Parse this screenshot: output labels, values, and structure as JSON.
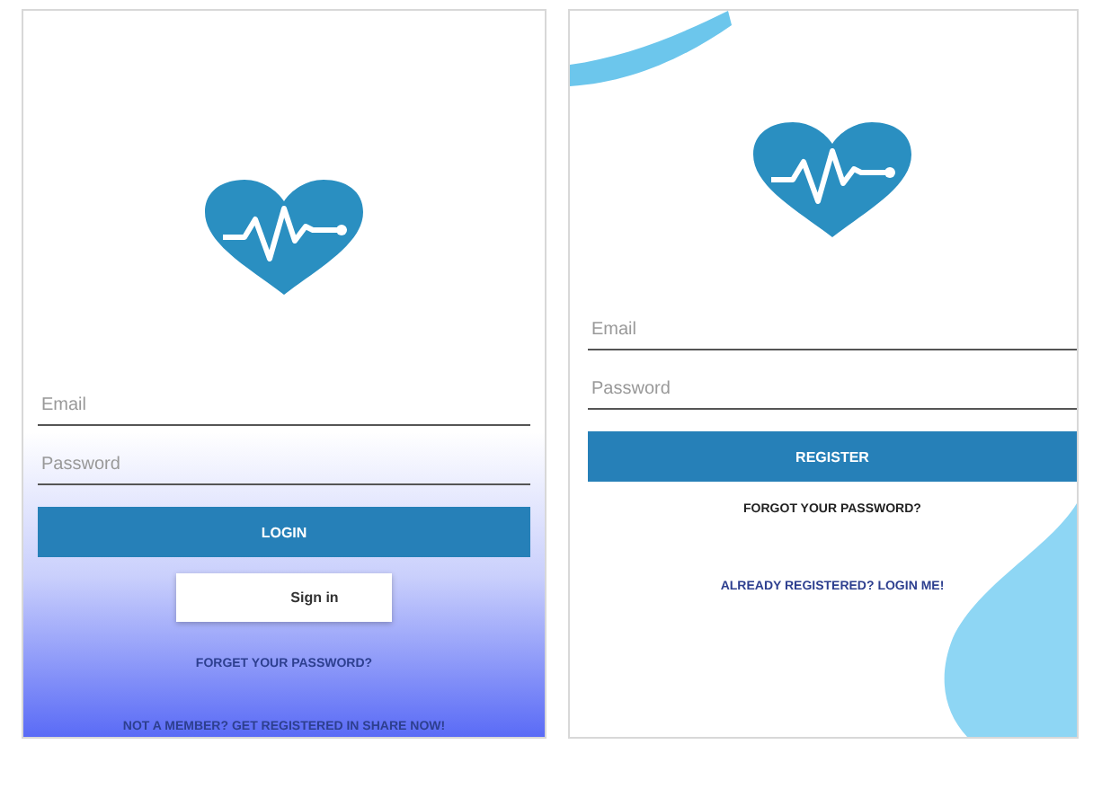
{
  "screens": [
    {
      "kind": "login",
      "fields": [
        {
          "placeholder": "Email"
        },
        {
          "placeholder": "Password"
        }
      ],
      "primary_button": "LOGIN",
      "secondary_button": "Sign in",
      "links": [
        "FORGET YOUR PASSWORD?",
        "NOT A MEMBER? GET REGISTERED IN SHARE NOW!"
      ]
    },
    {
      "kind": "register",
      "fields": [
        {
          "placeholder": "Email"
        },
        {
          "placeholder": "Password"
        }
      ],
      "primary_button": "REGISTER",
      "links": [
        "FORGOT YOUR PASSWORD?",
        "ALREADY REGISTERED? LOGIN ME!"
      ]
    }
  ]
}
